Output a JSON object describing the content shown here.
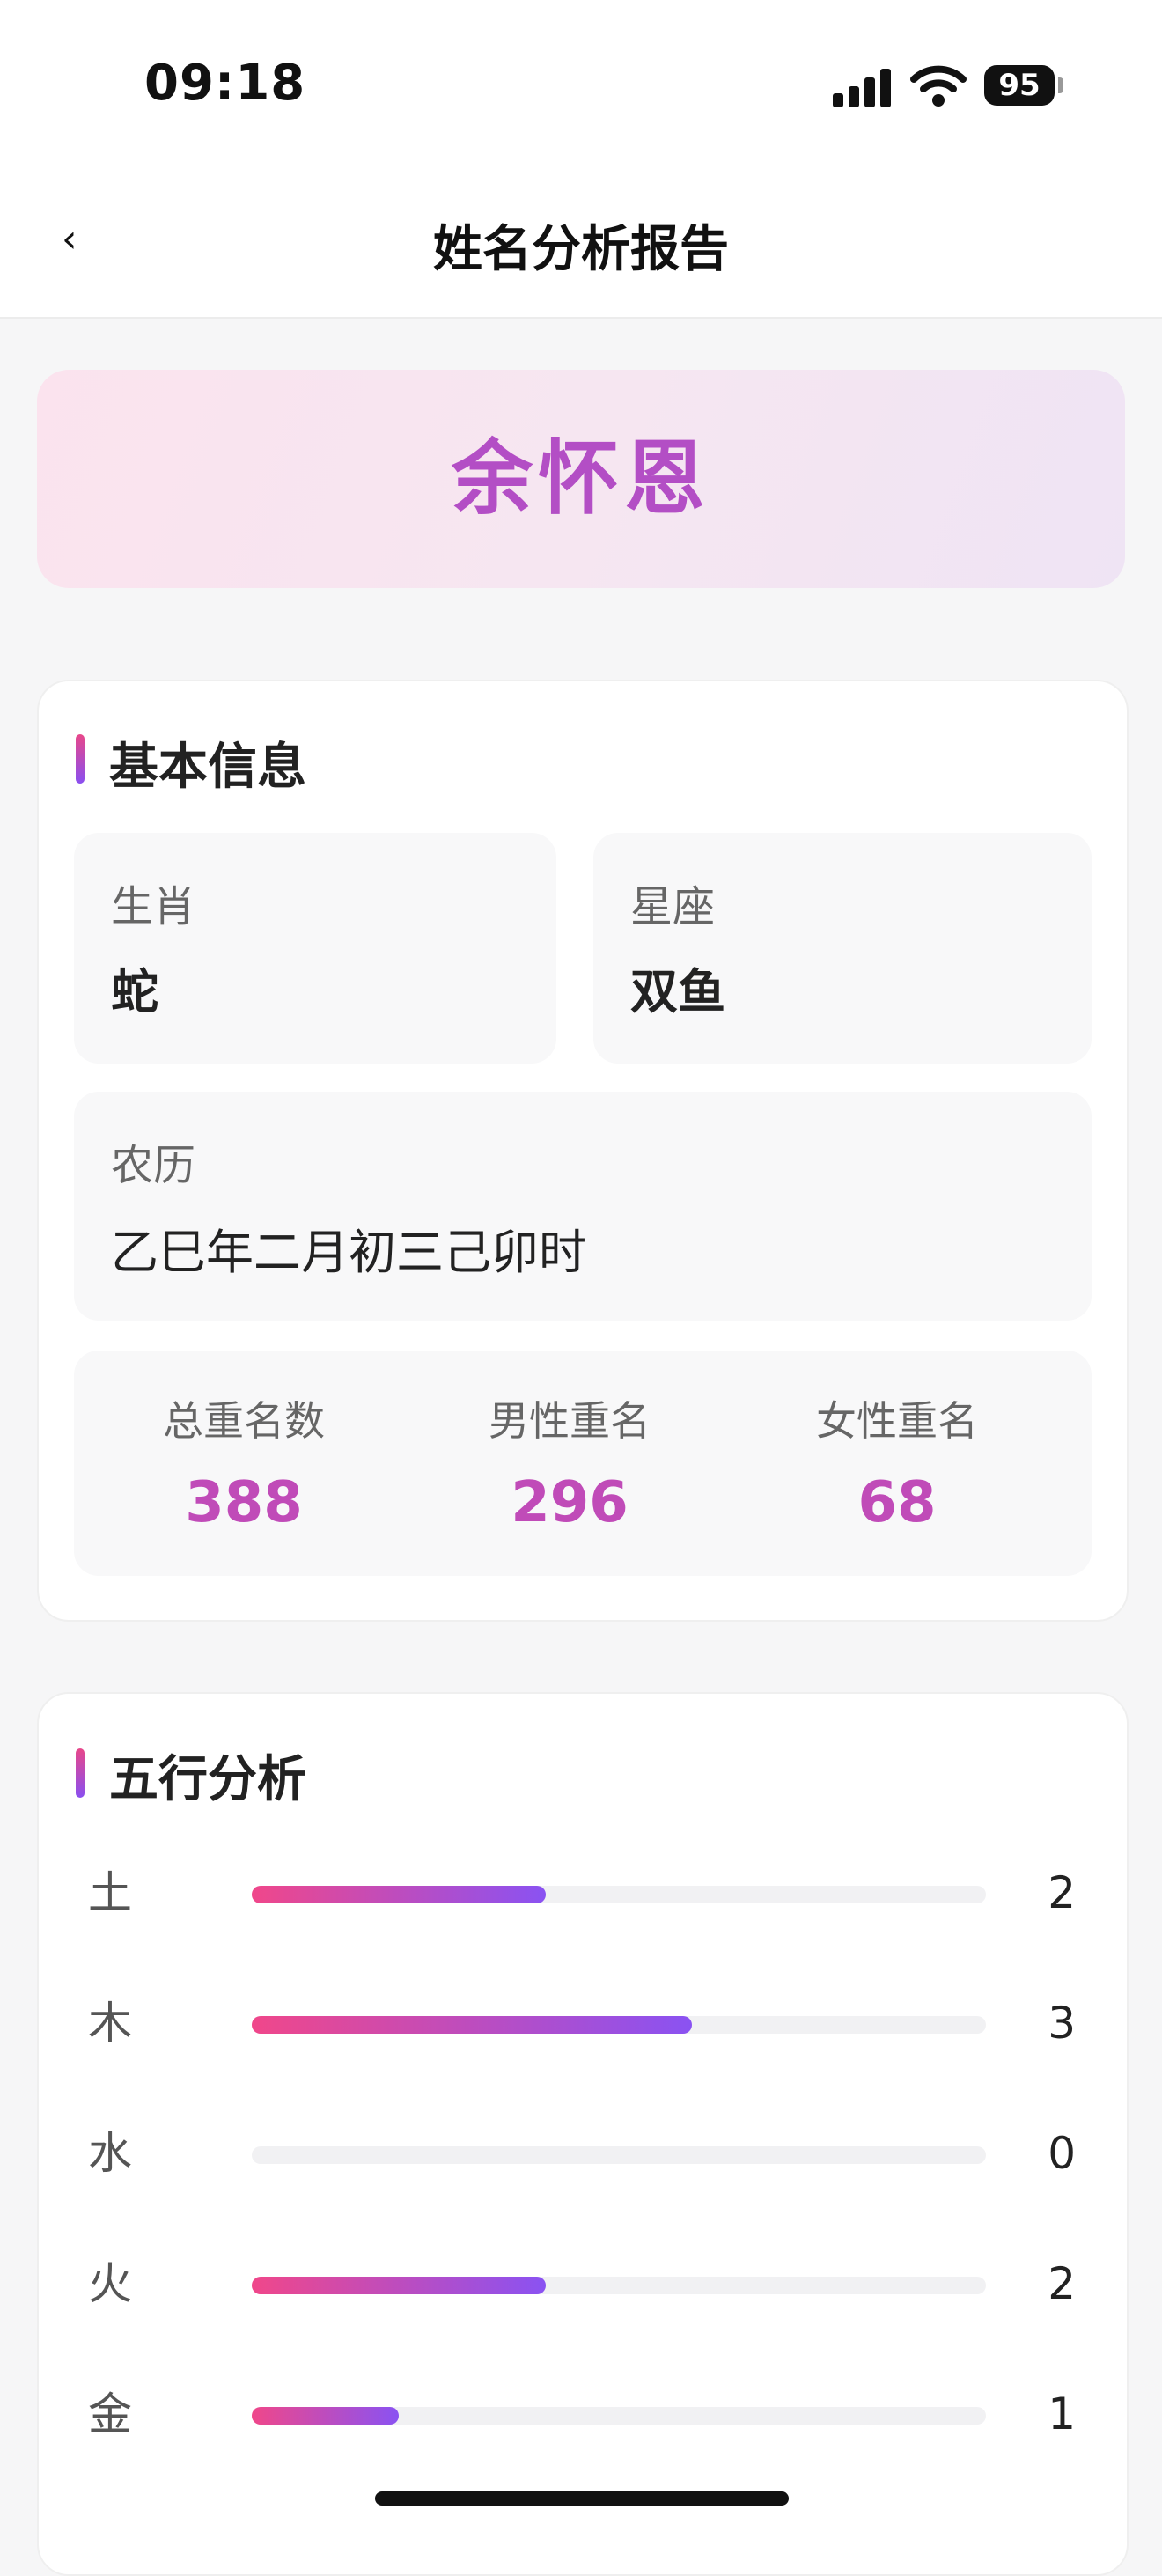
{
  "status_bar": {
    "time": "09:18",
    "battery": "95"
  },
  "nav": {
    "back_label": "‹",
    "title": "姓名分析报告"
  },
  "banner": {
    "name": "余怀恩"
  },
  "basic_info": {
    "title": "基本信息",
    "zodiac_label": "生肖",
    "zodiac_value": "蛇",
    "constellation_label": "星座",
    "constellation_value": "双鱼",
    "lunar_label": "农历",
    "lunar_value": "乙巳年二月初三己卯时",
    "stats": [
      {
        "label": "总重名数",
        "value": "388"
      },
      {
        "label": "男性重名",
        "value": "296"
      },
      {
        "label": "女性重名",
        "value": "68"
      }
    ]
  },
  "wuxing": {
    "title": "五行分析",
    "max": 5,
    "items": [
      {
        "label": "土",
        "count": "2",
        "value": 2
      },
      {
        "label": "木",
        "count": "3",
        "value": 3
      },
      {
        "label": "水",
        "count": "0",
        "value": 0
      },
      {
        "label": "火",
        "count": "2",
        "value": 2
      },
      {
        "label": "金",
        "count": "1",
        "value": 1
      }
    ]
  },
  "colors": {
    "accent_pink": "#f0478a",
    "accent_purple": "#8a52f2",
    "name_color": "#b34ec5"
  }
}
